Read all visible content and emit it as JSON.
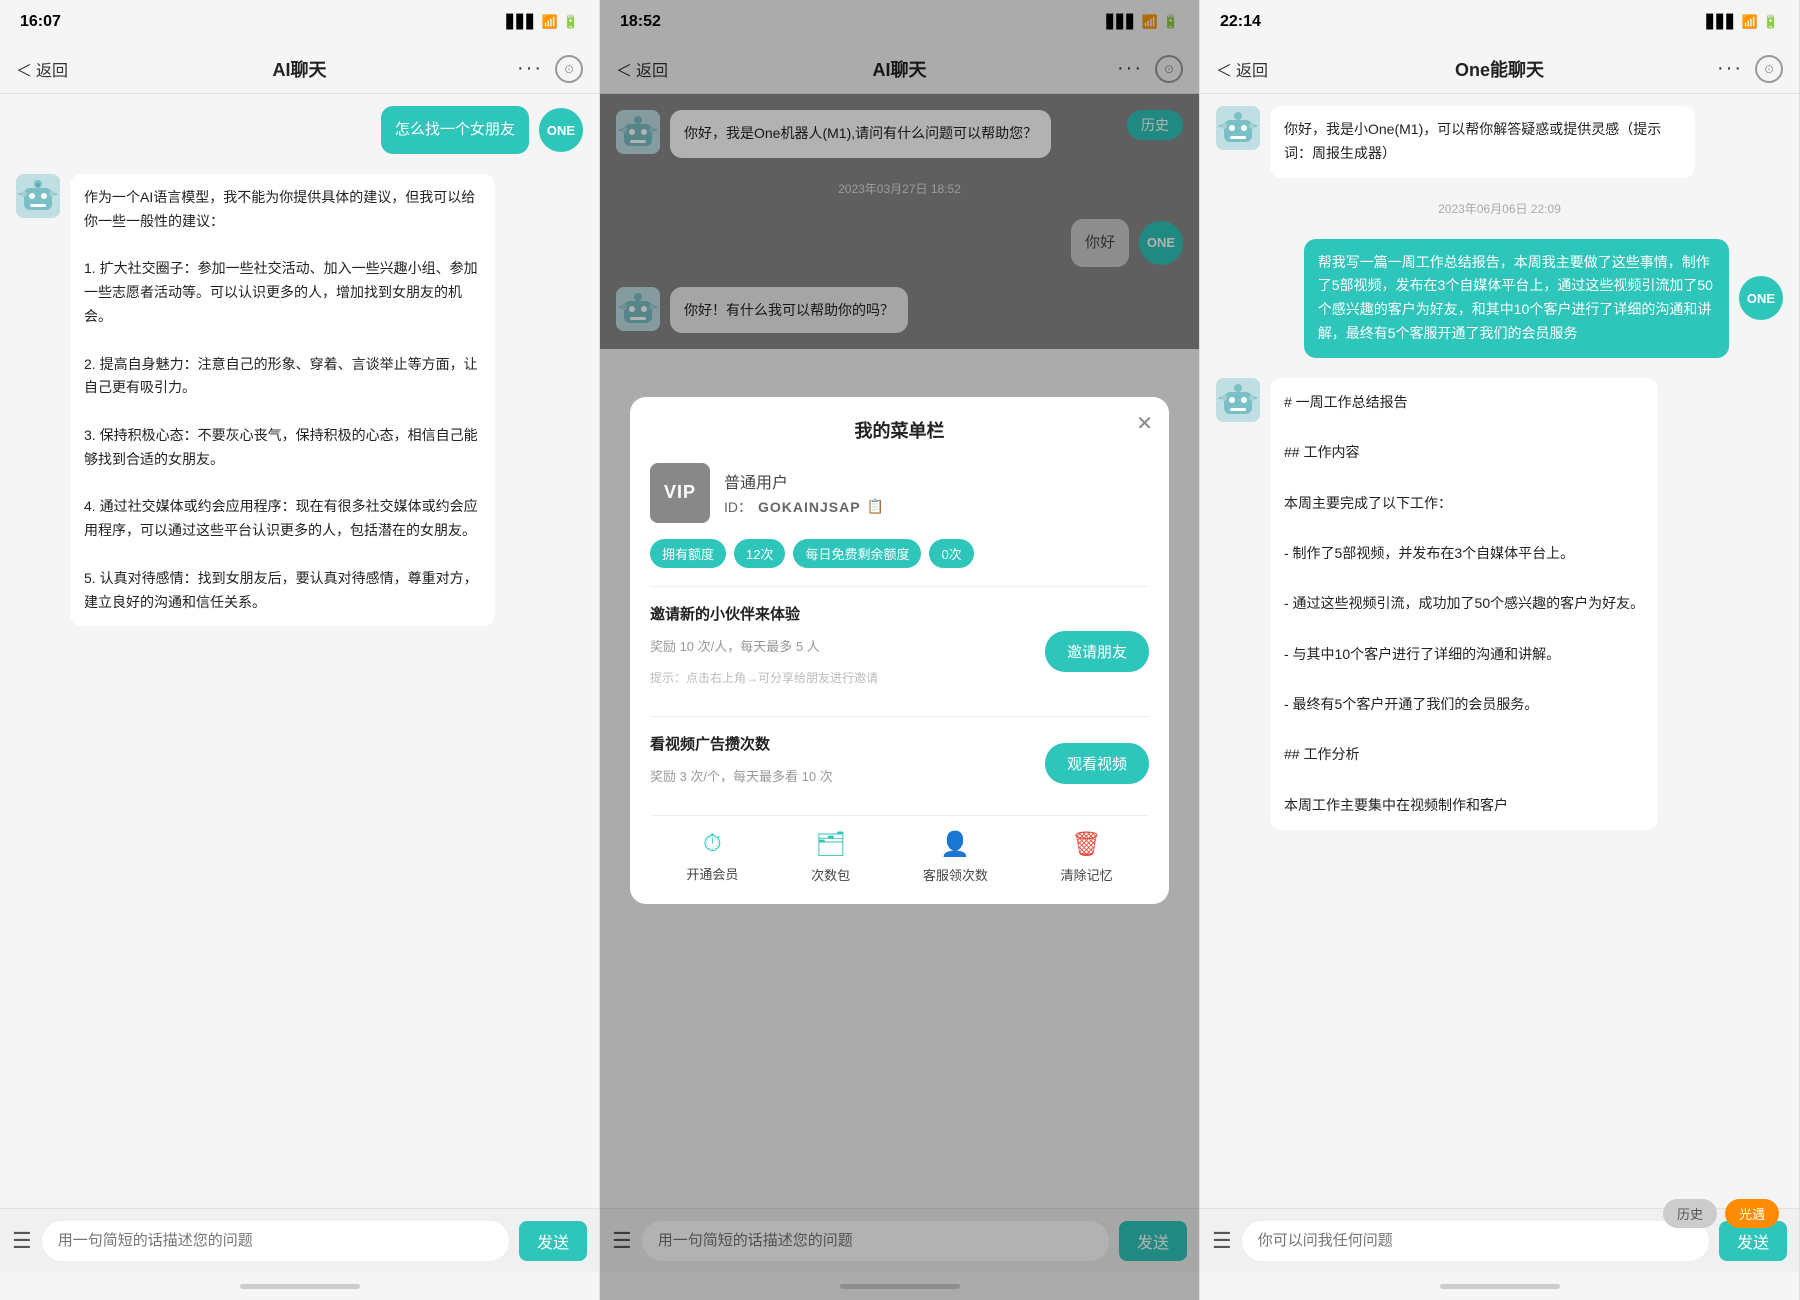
{
  "panels": [
    {
      "id": "panel1",
      "status": {
        "time": "16:07",
        "signal": true,
        "wifi": true,
        "battery": true
      },
      "nav": {
        "back": "返回",
        "title": "AI聊天",
        "dots": "···",
        "circle": "⊙"
      },
      "messages": [
        {
          "type": "user-bubble",
          "text": "怎么找一个女朋友",
          "style": "teal"
        },
        {
          "type": "bot",
          "text": "作为一个AI语言模型，我不能为你提供具体的建议，但我可以给你一些一般性的建议：\n\n1. 扩大社交圈子：参加一些社交活动、加入一些兴趣小组、参加一些志愿者活动等。可以认识更多的人，增加找到女朋友的机会。\n\n2. 提高自身魅力：注意自己的形象、穿着、言谈举止等方面，让自己更有吸引力。\n\n3. 保持积极心态：不要灰心丧气，保持积极的心态，相信自己能够找到合适的女朋友。\n\n4. 通过社交媒体或约会应用程序：现在有很多社交媒体或约会应用程序，可以通过这些平台认识更多的人，包括潜在的女朋友。\n\n5. 认真对待感情：找到女朋友后，要认真对待感情，尊重对方，建立良好的沟通和信任关系。"
        }
      ],
      "input": {
        "placeholder": "用一句简短的话描述您的问题",
        "send": "发送",
        "menu_icon": "☰"
      }
    },
    {
      "id": "panel2",
      "status": {
        "time": "18:52",
        "signal": true,
        "wifi": true,
        "battery": true
      },
      "nav": {
        "back": "返回",
        "title": "AI聊天",
        "dots": "···",
        "circle": "⊙",
        "history": "历史"
      },
      "messages": [
        {
          "type": "bot",
          "text": "你好，我是One机器人(M1),请问有什么问题可以帮助您？"
        },
        {
          "type": "date",
          "text": "2023年03月27日 18:52"
        },
        {
          "type": "user-simple",
          "text": "你好"
        },
        {
          "type": "bot",
          "text": "你好！有什么我可以帮助你的吗？"
        }
      ],
      "modal": {
        "title": "我的菜单栏",
        "close": "✕",
        "vip": {
          "badge": "VIP",
          "type": "普通用户",
          "id_label": "ID：",
          "id_value": "GOKAINJSAP",
          "copy_icon": "📋"
        },
        "quota": {
          "tag1": "拥有额度",
          "count1": "12次",
          "tag2": "每日免费剩余额度",
          "count2": "0次"
        },
        "invite": {
          "title": "邀请新的小伙伴来体验",
          "desc": "奖励 10 次/人，每天最多 5 人",
          "note": "提示：点击右上角→可分享给朋友进行邀请",
          "btn": "邀请朋友"
        },
        "video": {
          "title": "看视频广告攒次数",
          "desc": "奖励 3 次/个，每天最多看 10 次",
          "btn": "观看视频"
        },
        "tabs": [
          {
            "icon": "⏱",
            "label": "开通会员",
            "color": "teal"
          },
          {
            "icon": "🗑",
            "label": "次数包",
            "color": "teal"
          },
          {
            "icon": "👤",
            "label": "客服领次数",
            "color": "teal"
          },
          {
            "icon": "🗑",
            "label": "清除记忆",
            "color": "red"
          }
        ]
      },
      "input": {
        "placeholder": "用一句简短的话描述您的问题",
        "send": "发送",
        "menu_icon": "☰"
      }
    },
    {
      "id": "panel3",
      "status": {
        "time": "22:14",
        "signal": true,
        "wifi": true,
        "battery": true
      },
      "nav": {
        "back": "返回",
        "title": "One能聊天",
        "dots": "···",
        "circle": "⊙"
      },
      "messages": [
        {
          "type": "bot",
          "text": "你好，我是小One(M1)，可以帮你解答疑惑或提供灵感（提示词：周报生成器）"
        },
        {
          "type": "date",
          "text": "2023年06月06日 22:09"
        },
        {
          "type": "user",
          "text": "帮我写一篇一周工作总结报告，本周我主要做了这些事情，制作了5部视频，发布在3个自媒体平台上，通过这些视频引流加了50个感兴趣的客户为好友，和其中10个客户进行了详细的沟通和讲解，最终有5个客服开通了我们的会员服务"
        },
        {
          "type": "bot",
          "text": "# 一周工作总结报告\n\n## 工作内容\n\n本周主要完成了以下工作：\n\n- 制作了5部视频，并发布在3个自媒体平台上。\n\n- 通过这些视频引流，成功加了50个感兴趣的客户为好友。\n\n- 与其中10个客户进行了详细的沟通和讲解。\n\n- 最终有5个客户开通了我们的会员服务。\n\n## 工作分析\n\n本周工作主要集中在视频制作和客户"
        }
      ],
      "bottom_tags": [
        {
          "label": "历史",
          "style": "gray"
        },
        {
          "label": "光遇",
          "style": "orange"
        }
      ],
      "input": {
        "placeholder": "你可以问我任何问题",
        "send": "发送",
        "menu_icon": "☰"
      }
    }
  ]
}
